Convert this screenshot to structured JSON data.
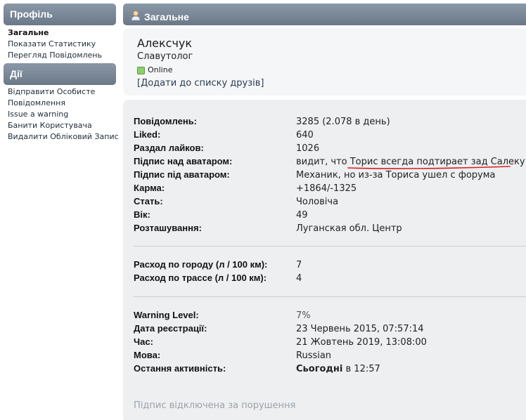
{
  "sidebar": {
    "profile_title": "Профіль",
    "profile_items": [
      {
        "label": "Загальне",
        "active": true
      },
      {
        "label": "Показати Статистику"
      },
      {
        "label": "Перегляд Повідомлень"
      }
    ],
    "actions_title": "Дії",
    "action_items": [
      {
        "label": "Відправити Особисте"
      },
      {
        "label": "Повідомлення"
      },
      {
        "label": "Issue a warning"
      },
      {
        "label": "Банити Користувача"
      },
      {
        "label": "Видалити Обліковий Запис"
      }
    ]
  },
  "main": {
    "title": "Загальне",
    "user": {
      "name": "Алексчук",
      "title": "Славутолог",
      "status": "Online",
      "add_friend": "[Додати до списку друзів]"
    },
    "stats_group1": [
      {
        "label": "Повідомлень:",
        "value": "3285 (2.078 в день)"
      },
      {
        "label": "Liked:",
        "value": "640"
      },
      {
        "label": "Раздал лайков:",
        "value": "1026"
      },
      {
        "label": "Підпис над аватаром:",
        "value": "видит, что Торис всегда подтирает зад Салеку"
      },
      {
        "label": "Підпис під аватаром:",
        "value": "Механик, но из-за Ториса ушел с форума"
      },
      {
        "label": "Карма:",
        "value": "+1864/-1325"
      },
      {
        "label": "Стать:",
        "value": "Чоловіча"
      },
      {
        "label": "Вік:",
        "value": "49"
      },
      {
        "label": "Розташування:",
        "value": "Луганская обл. Центр"
      }
    ],
    "stats_group2": [
      {
        "label": "Расход по городу (л / 100 км):",
        "value": "7"
      },
      {
        "label": "Расход по трассе (л / 100 км):",
        "value": "4"
      }
    ],
    "stats_group3": [
      {
        "label": "Warning Level:",
        "value": "7%"
      },
      {
        "label": "Дата реєстрації:",
        "value": "23 Червень 2015, 07:57:14"
      },
      {
        "label": "Час:",
        "value": "21 Жовтень 2019, 13:08:00"
      },
      {
        "label": "Мова:",
        "value": "Russian"
      },
      {
        "label": "Остання активність:",
        "value_bold": "Сьогодні",
        "value": "в 12:57"
      }
    ],
    "footer_note": "Підпис відключена за порушення"
  },
  "colors": {
    "header_bg": "#7a8898",
    "online": "#8cd06b",
    "annotation": "#d42020"
  }
}
